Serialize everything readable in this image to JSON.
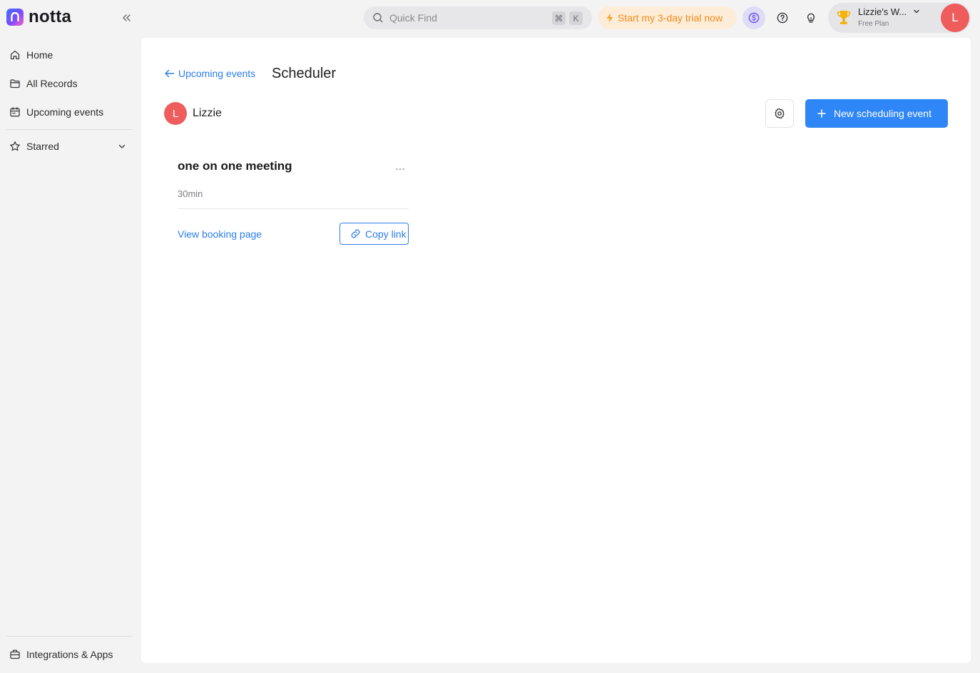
{
  "app": {
    "logo_text": "notta"
  },
  "sidebar": {
    "items": [
      {
        "label": "Home",
        "icon": "home-icon"
      },
      {
        "label": "All Records",
        "icon": "folder-icon"
      },
      {
        "label": "Upcoming events",
        "icon": "calendar-icon"
      }
    ],
    "starred_label": "Starred",
    "integrations_label": "Integrations & Apps"
  },
  "topbar": {
    "search_placeholder": "Quick Find",
    "shortcut_keys": [
      "⌘",
      "K"
    ],
    "trial_label": "Start my 3-day trial now",
    "workspace_name": "Lizzie's W...",
    "workspace_plan": "Free Plan",
    "avatar_initial": "L"
  },
  "main": {
    "back_label": "Upcoming events",
    "page_title": "Scheduler",
    "user": {
      "initial": "L",
      "name": "Lizzie"
    },
    "new_event_label": "New scheduling event",
    "events": [
      {
        "title": "one on one meeting",
        "duration": "30min",
        "view_label": "View booking page",
        "copy_label": "Copy link"
      }
    ]
  },
  "colors": {
    "accent": "#2f86f6",
    "link": "#2b7de9",
    "avatar": "#ef5c5c",
    "trial_text": "#f08c1a",
    "trial_bg": "#fdecd8"
  }
}
